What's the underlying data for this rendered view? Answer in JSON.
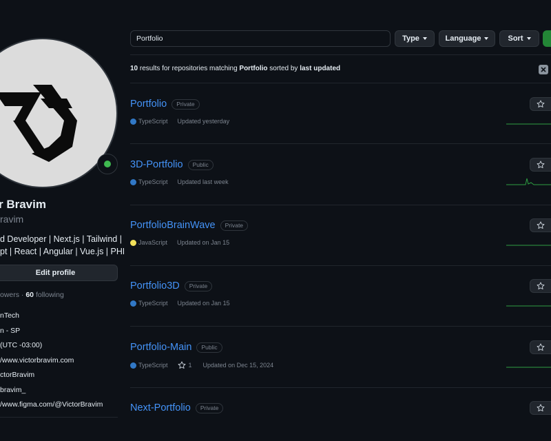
{
  "profile": {
    "name": "Victor Bravim",
    "name_visible": "r Bravim",
    "login_visible": "ravim",
    "bio_lines": [
      "d Developer | Next.js | Tailwind |",
      "pt | React | Angular | Vue.js | PHP"
    ],
    "edit_label": "Edit profile",
    "followers_prefix": "owers · ",
    "following_count": "60",
    "following_label": " following",
    "vcard": [
      "nTech",
      "n - SP",
      "(UTC -03:00)",
      "/www.victorbravim.com",
      "ctorBravim",
      "bravim_",
      "/www.figma.com/@VictorBravim"
    ],
    "status_color": "#3fb950"
  },
  "filters": {
    "search_value": "Portfolio",
    "type_label": "Type",
    "language_label": "Language",
    "sort_label": "Sort"
  },
  "results": {
    "count": "10",
    "text1": " results for repositories matching ",
    "query": "Portfolio",
    "text2": " sorted by ",
    "sort_key": "last updated"
  },
  "repos": [
    {
      "name": "Portfolio",
      "visibility": "Private",
      "language": "TypeScript",
      "lang_color": "#3178c6",
      "stars": "",
      "updated": "Updated yesterday",
      "spark": "flat"
    },
    {
      "name": "3D-Portfolio",
      "visibility": "Public",
      "language": "TypeScript",
      "lang_color": "#3178c6",
      "stars": "",
      "updated": "Updated last week",
      "spark": "spike"
    },
    {
      "name": "PortfolioBrainWave",
      "visibility": "Private",
      "language": "JavaScript",
      "lang_color": "#f1e05a",
      "stars": "",
      "updated": "Updated on Jan 15",
      "spark": "flat"
    },
    {
      "name": "Portfolio3D",
      "visibility": "Private",
      "language": "TypeScript",
      "lang_color": "#3178c6",
      "stars": "",
      "updated": "Updated on Jan 15",
      "spark": "flat"
    },
    {
      "name": "Portfolio-Main",
      "visibility": "Public",
      "language": "TypeScript",
      "lang_color": "#3178c6",
      "stars": "1",
      "updated": "Updated on Dec 15, 2024",
      "spark": "flat"
    },
    {
      "name": "Next-Portfolio",
      "visibility": "Private",
      "language": "",
      "lang_color": "",
      "stars": "",
      "updated": "",
      "spark": "none"
    }
  ],
  "colors": {
    "link": "#4493f8",
    "accent_green": "#238636",
    "bg": "#0d1117"
  }
}
